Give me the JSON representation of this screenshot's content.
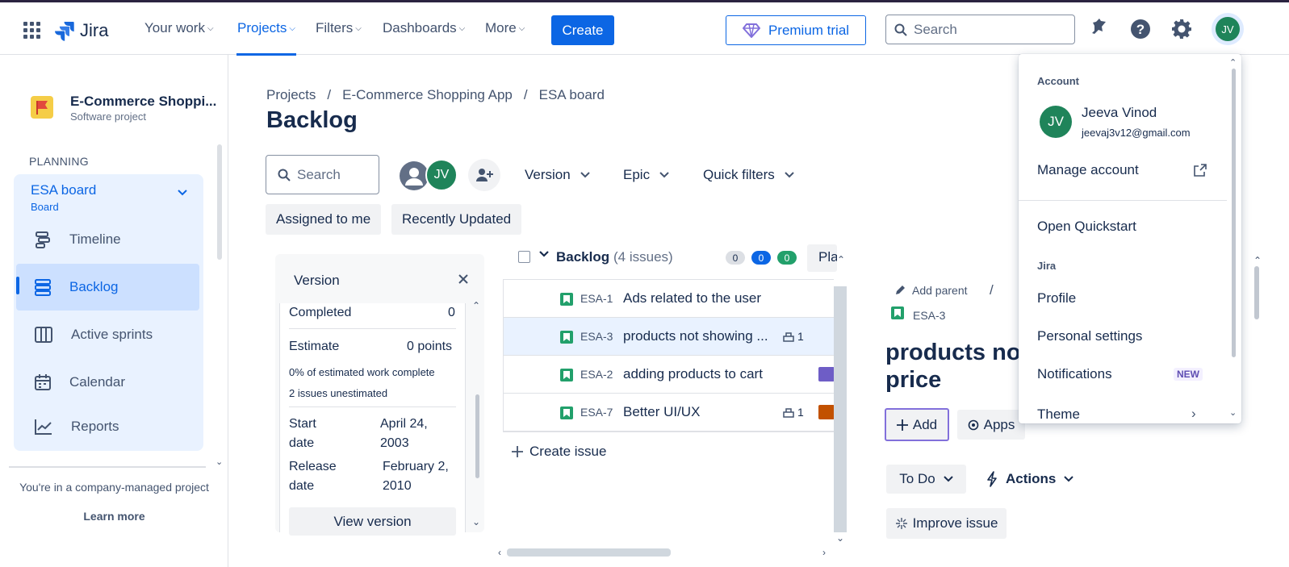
{
  "topbar": {
    "app_name": "Jira",
    "nav": {
      "your_work": "Your work",
      "projects": "Projects",
      "filters": "Filters",
      "dashboards": "Dashboards",
      "more": "More"
    },
    "create": "Create",
    "premium_trial": "Premium trial",
    "search_placeholder": "Search",
    "avatar_initials": "JV"
  },
  "sidebar": {
    "project_name": "E-Commerce Shoppi...",
    "project_type": "Software project",
    "section": "PLANNING",
    "board": {
      "name": "ESA board",
      "sub": "Board"
    },
    "items": [
      {
        "label": "Timeline",
        "icon": "timeline-icon"
      },
      {
        "label": "Backlog",
        "icon": "backlog-icon"
      },
      {
        "label": "Active sprints",
        "icon": "board-icon"
      },
      {
        "label": "Calendar",
        "icon": "calendar-icon"
      },
      {
        "label": "Reports",
        "icon": "reports-icon"
      }
    ],
    "footer_text": "You're in a company-managed project",
    "learn_more": "Learn more"
  },
  "main": {
    "breadcrumb": [
      "Projects",
      "/",
      "E-Commerce Shopping App",
      "/",
      "ESA board"
    ],
    "title": "Backlog",
    "search_placeholder": "Search",
    "avatar_initials": "JV",
    "filters": {
      "version": "Version",
      "epic": "Epic",
      "quick_filters": "Quick filters"
    },
    "chips": [
      "Assigned to me",
      "Recently Updated"
    ]
  },
  "version_panel": {
    "title": "Version",
    "completed_label": "Completed",
    "completed_value": "0",
    "estimate_label": "Estimate",
    "estimate_value": "0 points",
    "pct_text": "0% of estimated work complete",
    "unestimated_text": "2 issues unestimated",
    "start_label_1": "Start",
    "start_label_2": "date",
    "start_value_1": "April 24,",
    "start_value_2": "2003",
    "release_label_1": "Release",
    "release_label_2": "date",
    "release_value_1": "February 2,",
    "release_value_2": "2010",
    "view_version": "View version"
  },
  "backlog": {
    "label": "Backlog",
    "count": "(4 issues)",
    "pills": [
      "0",
      "0",
      "0"
    ],
    "plan_btn": "Pla",
    "issues": [
      {
        "key": "ESA-1",
        "summary": "Ads related to the user",
        "children": "",
        "epic_color": ""
      },
      {
        "key": "ESA-3",
        "summary": "products not showing ...",
        "children": "1",
        "epic_color": ""
      },
      {
        "key": "ESA-2",
        "summary": "adding products to cart",
        "children": "",
        "epic_color": "#6e5dc6"
      },
      {
        "key": "ESA-7",
        "summary": "Better UI/UX",
        "children": "1",
        "epic_color": "#c25100"
      }
    ],
    "create_issue": "Create issue"
  },
  "detail": {
    "add_parent": "Add parent",
    "separator": "/",
    "key": "ESA-3",
    "title_line1": "products not",
    "title_line2": "price",
    "add": "Add",
    "apps": "Apps",
    "status": "To Do",
    "actions": "Actions",
    "improve": "Improve issue"
  },
  "account_menu": {
    "account_heading": "Account",
    "user_name": "Jeeva Vinod",
    "user_email": "jeevaj3v12@gmail.com",
    "avatar_initials": "JV",
    "manage_account": "Manage account",
    "open_quickstart": "Open Quickstart",
    "jira_heading": "Jira",
    "profile": "Profile",
    "personal_settings": "Personal settings",
    "notifications": "Notifications",
    "new_badge": "NEW",
    "theme": "Theme"
  },
  "colors": {
    "brand_blue": "#0c66e4",
    "avatar_green": "#1f845a",
    "story_green": "#22a06b"
  }
}
